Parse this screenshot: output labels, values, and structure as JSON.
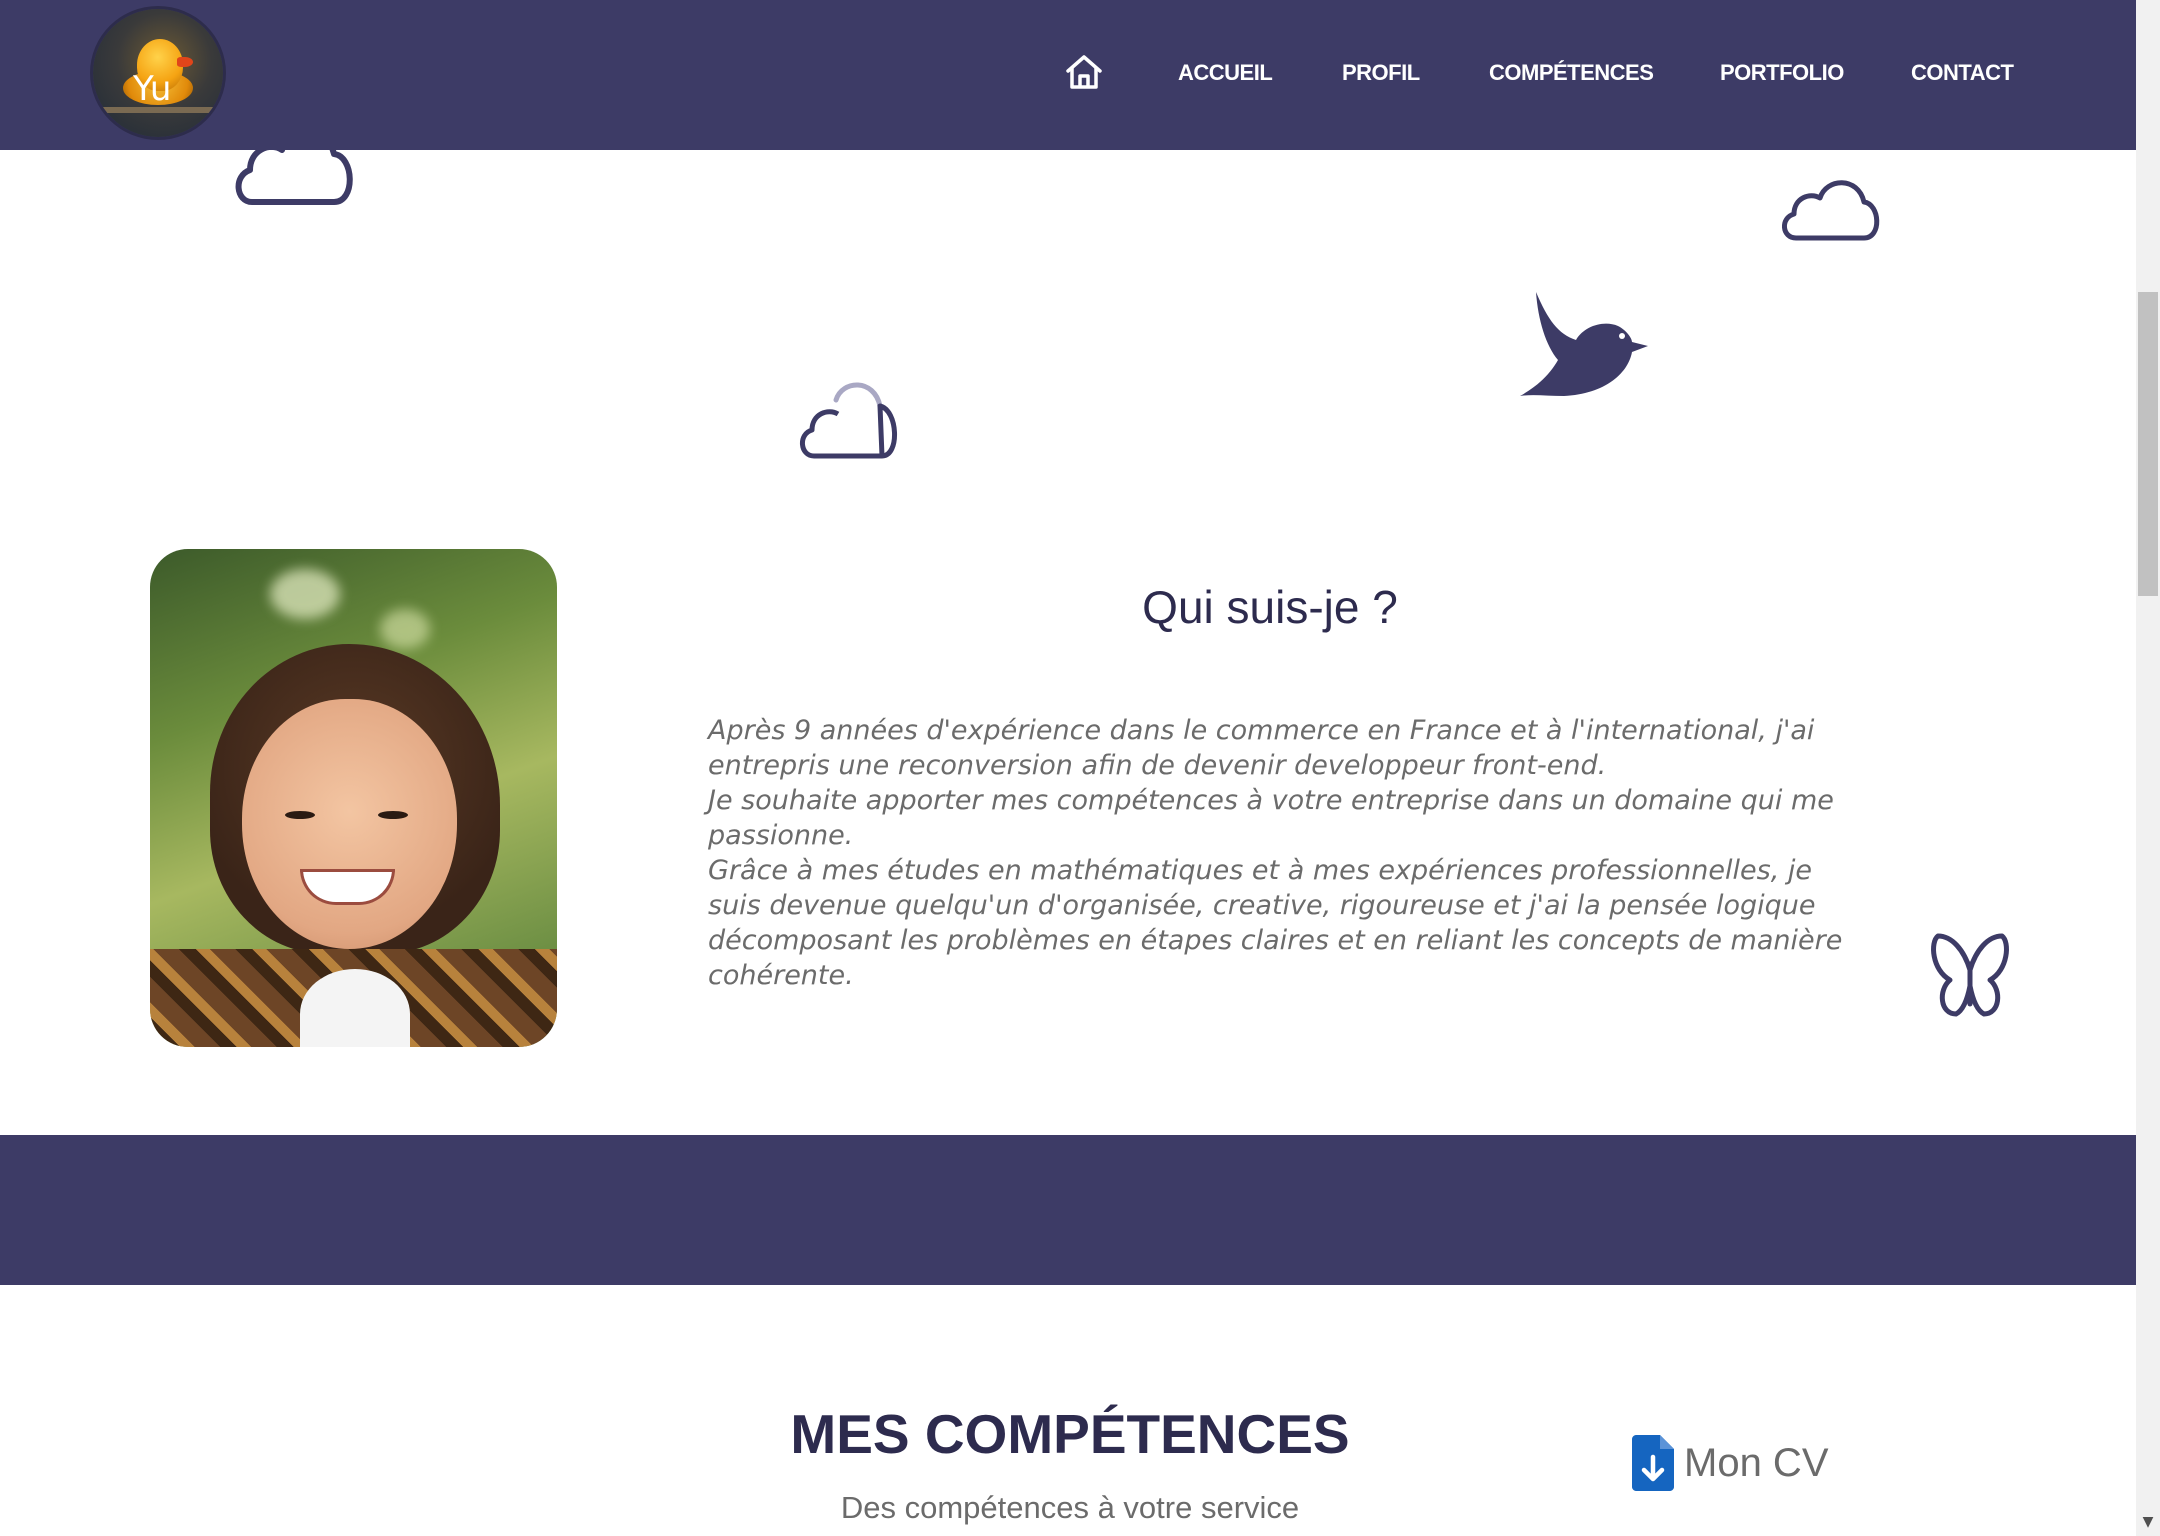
{
  "header": {
    "logo_text": "Yu",
    "nav": {
      "home_icon": "home-icon",
      "items": [
        "ACCUEIL",
        "PROFIL",
        "COMPÉTENCES",
        "PORTFOLIO",
        "CONTACT"
      ]
    }
  },
  "about": {
    "title": "Qui suis-je ?",
    "paragraphs": [
      "Après 9 années d'expérience dans le commerce en France et à l'international, j'ai entrepris une reconversion afin de devenir developpeur front-end.",
      "Je souhaite apporter mes compétences à votre entreprise dans un domaine qui me passionne.",
      "Grâce à mes études en mathématiques et à mes expériences professionnelles, je suis devenue quelqu'un d'organisée, creative, rigoureuse et j'ai la pensée logique décomposant les problèmes en étapes claires et en reliant les concepts de manière cohérente."
    ]
  },
  "skills": {
    "title": "MES COMPÉTENCES",
    "subtitle": "Des compétences à votre service",
    "cv_label": "Mon CV",
    "cv_icon": "file-download-icon"
  },
  "colors": {
    "primary": "#3d3b66",
    "heading": "#2d2b4e",
    "text_muted": "#6b6b6b",
    "cv_icon": "#1565c0"
  },
  "decorations": [
    "cloud-icon",
    "cloud-icon",
    "cloud-icon",
    "bird-icon",
    "butterfly-icon"
  ]
}
